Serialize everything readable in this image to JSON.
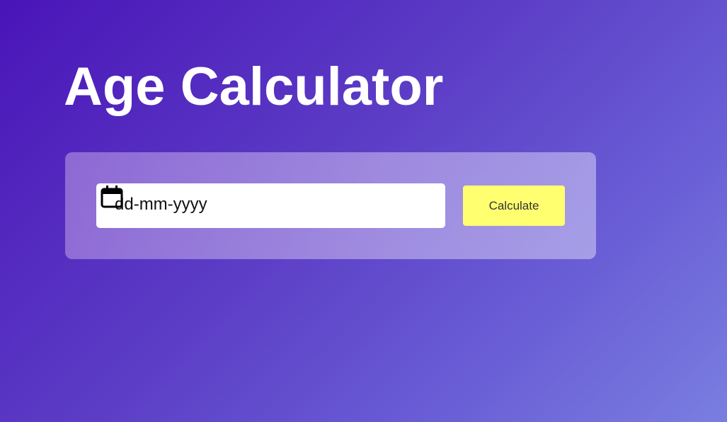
{
  "page": {
    "title": "Age Calculator"
  },
  "form": {
    "date_input": {
      "placeholder": "dd-mm-yyyy",
      "value": ""
    },
    "calendar_icon": "calendar-icon",
    "calculate_label": "Calculate"
  },
  "colors": {
    "background_start": "#4a14b8",
    "background_end": "#7a7ee0",
    "button": "#ffff70",
    "title": "#ffffff"
  }
}
